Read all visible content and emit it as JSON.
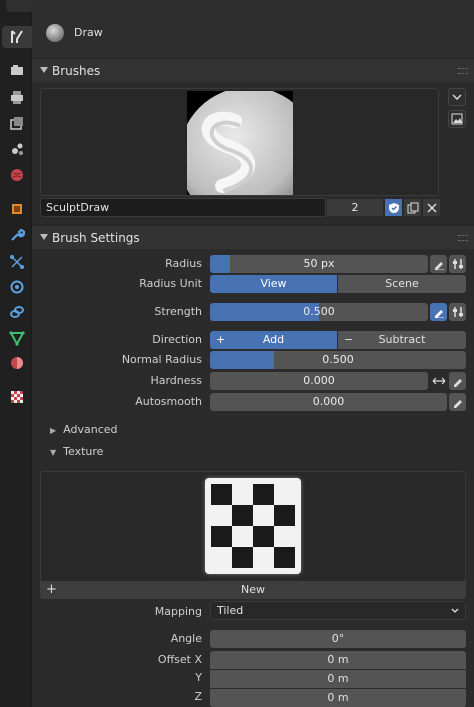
{
  "tabs": [
    "tool-tab",
    "render-tab",
    "output-tab",
    "view-layer-tab",
    "scene-tab",
    "world-tab",
    "object-tab",
    "modifiers-tab",
    "particles-tab",
    "physics-tab",
    "constraints-tab",
    "data-tab",
    "material-tab",
    "texture-tab"
  ],
  "context": {
    "brush_name": "Draw"
  },
  "brushes_panel": {
    "title": "Brushes",
    "brush_field_value": "SculptDraw",
    "user_count": "2"
  },
  "brush_settings": {
    "title": "Brush Settings",
    "radius": {
      "label": "Radius",
      "value": "50 px",
      "fill": 0.09
    },
    "radius_unit": {
      "label": "Radius Unit",
      "options": [
        "View",
        "Scene"
      ],
      "selected": "View"
    },
    "strength": {
      "label": "Strength",
      "value": "0.500",
      "fill": 0.5
    },
    "direction": {
      "label": "Direction",
      "options": [
        "Add",
        "Subtract"
      ],
      "selected": "Add",
      "add_prefix": "+",
      "subtract_prefix": "−"
    },
    "normal_radius": {
      "label": "Normal Radius",
      "value": "0.500",
      "fill": 0.25
    },
    "hardness": {
      "label": "Hardness",
      "value": "0.000"
    },
    "autosmooth": {
      "label": "Autosmooth",
      "value": "0.000"
    },
    "advanced_label": "Advanced",
    "texture_label": "Texture"
  },
  "texture": {
    "new_label": "New",
    "new_prefix": "+",
    "mapping": {
      "label": "Mapping",
      "value": "Tiled"
    },
    "angle": {
      "label": "Angle",
      "value": "0°"
    },
    "offset_x": {
      "label": "Offset X",
      "value": "0 m"
    },
    "offset_y": {
      "label": "Y",
      "value": "0 m"
    },
    "offset_z": {
      "label": "Z",
      "value": "0 m"
    }
  },
  "colors": {
    "accent": "#4772b3",
    "panel": "#2b2b2b",
    "field": "#545454"
  }
}
